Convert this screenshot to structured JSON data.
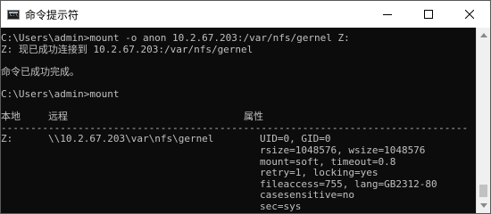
{
  "window": {
    "title": "命令提示符",
    "icon": "cmd-icon"
  },
  "console": {
    "cmd1": "C:\\Users\\admin>mount -o anon 10.2.67.203:/var/nfs/gernel Z:",
    "msg1": "Z: 现已成功连接到 10.2.67.203:/var/nfs/gernel",
    "msg2": "命令已成功完成。",
    "cmd2": "C:\\Users\\admin>mount",
    "header": {
      "local": "本地",
      "remote": "远程",
      "properties": "属性"
    },
    "separator": "-------------------------------------------------------------------------------",
    "entry": {
      "local": "Z:",
      "remote": "\\\\10.2.67.203\\var\\nfs\\gernel",
      "properties": [
        "UID=0, GID=0",
        "rsize=1048576, wsize=1048576",
        "mount=soft, timeout=0.8",
        "retry=1, locking=yes",
        "fileaccess=755, lang=GB2312-80",
        "casesensitive=no",
        "sec=sys"
      ]
    }
  }
}
